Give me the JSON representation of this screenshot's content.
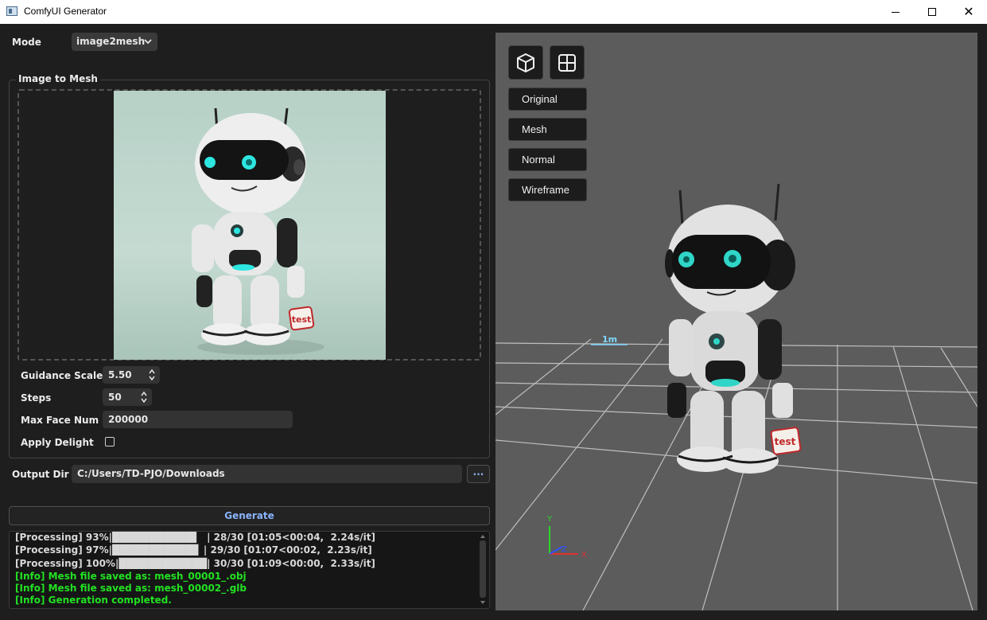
{
  "window": {
    "title": "ComfyUI Generator"
  },
  "controls": {
    "mode_label": "Mode",
    "mode_value": "image2mesh",
    "group_title": "Image to Mesh",
    "guidance_label": "Guidance Scale",
    "guidance_value": "5.50",
    "steps_label": "Steps",
    "steps_value": "50",
    "max_face_label": "Max Face Num",
    "max_face_value": "200000",
    "apply_delight_label": "Apply Delight",
    "apply_delight_checked": false,
    "output_dir_label": "Output Dir",
    "output_dir_value": "C:/Users/TD-PJO/Downloads",
    "browse_label": "...",
    "generate_label": "Generate"
  },
  "preview_image": {
    "badge_text": "test"
  },
  "log": {
    "lines": [
      {
        "text": "[Processing] 93%|███████████▌  | 28/30 [01:05<00:04,  2.24s/it]",
        "kind": "processing"
      },
      {
        "text": "[Processing] 97%|███████████▊ | 29/30 [01:07<00:02,  2.23s/it]",
        "kind": "processing"
      },
      {
        "text": "[Processing] 100%|████████████| 30/30 [01:09<00:00,  2.33s/it]",
        "kind": "processing"
      },
      {
        "text": "[Info] Mesh file saved as: mesh_00001_.obj",
        "kind": "info"
      },
      {
        "text": "[Info] Mesh file saved as: mesh_00002_.glb",
        "kind": "info"
      },
      {
        "text": "[Info] Generation completed.",
        "kind": "info"
      }
    ]
  },
  "viewer": {
    "view_buttons": [
      "Original",
      "Mesh",
      "Normal",
      "Wireframe"
    ],
    "scale_label": "1m",
    "model_badge_text": "test",
    "axis_labels": {
      "x": "X",
      "y": "Y",
      "z": "Z"
    }
  },
  "colors": {
    "accent_text": "#8ab4ff",
    "info_text": "#22e022",
    "viewport_bg": "#5c5c5c",
    "panel_bg": "#1e1e1e"
  }
}
